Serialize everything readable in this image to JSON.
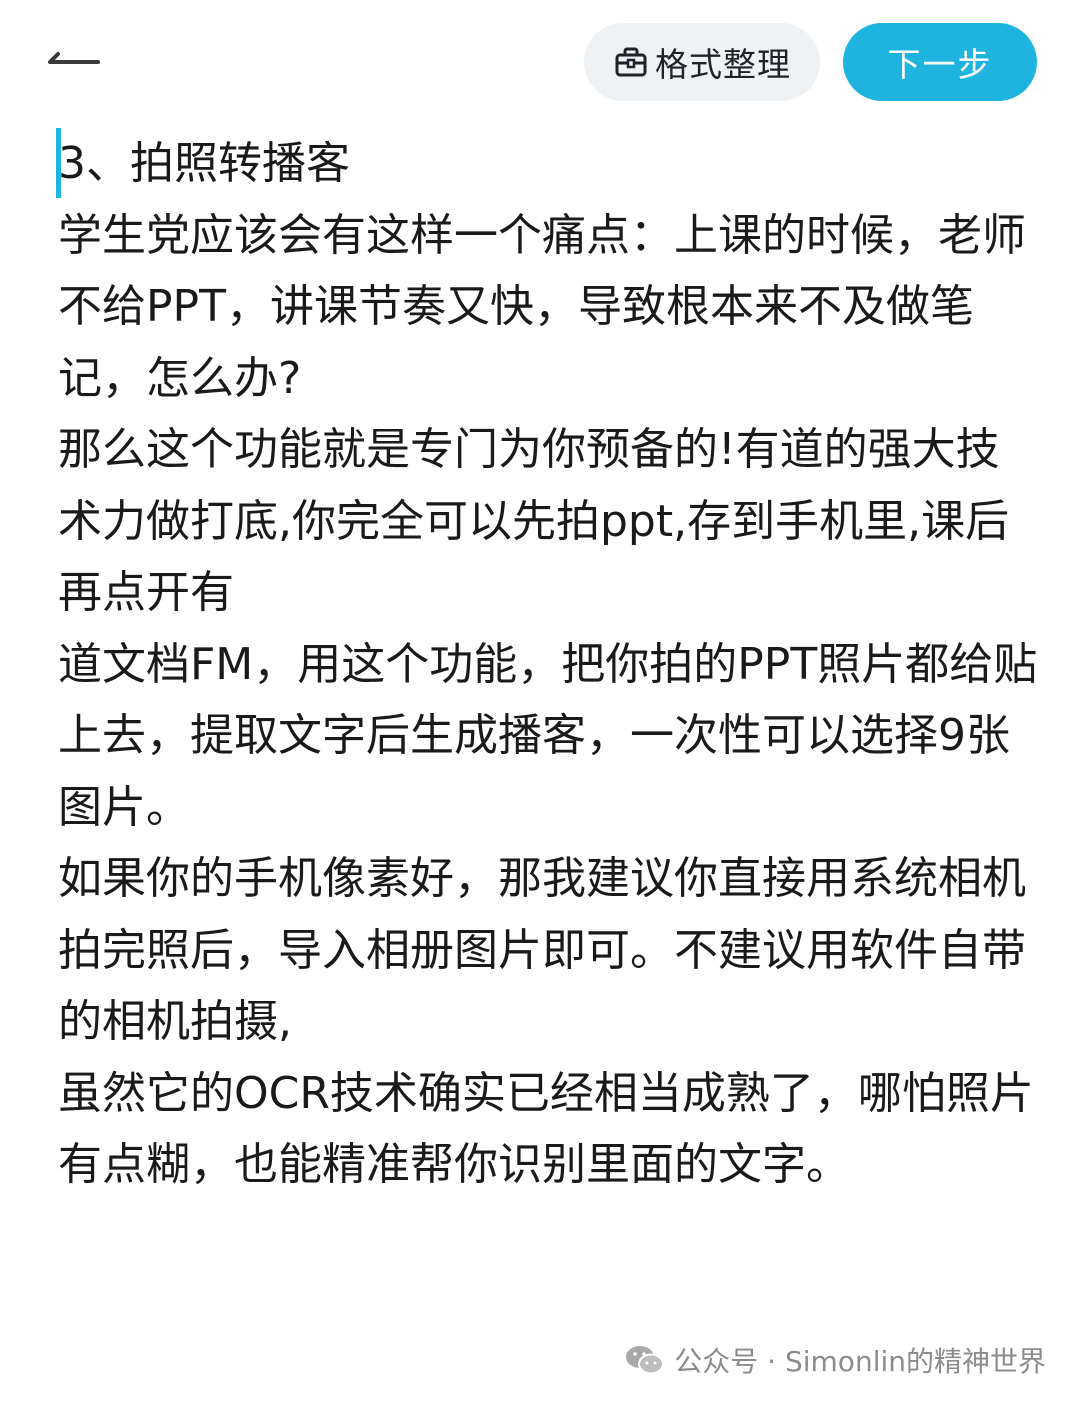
{
  "toolbar": {
    "format_label": "格式整理",
    "next_label": "下一步"
  },
  "icons": {
    "back": "back-arrow-icon",
    "format": "briefcase-icon",
    "watermark": "wechat-icon"
  },
  "colors": {
    "accent": "#1eb4dd",
    "format_button_bg": "#eef2f5",
    "text": "#1a1a1a",
    "watermark": "#8c8c8c"
  },
  "content": {
    "paragraphs": [
      "3、拍照转播客",
      "学生党应该会有这样一个痛点：上课的时候，老师不给PPT，讲课节奏又快，导致根本来不及做笔记，怎么办?",
      "那么这个功能就是专门为你预备的!有道的强大技术力做打底,你完全可以先拍ppt,存到手机里,课后再点开有",
      "道文档FM，用这个功能，把你拍的PPT照片都给贴上去，提取文字后生成播客，一次性可以选择9张图片。",
      "如果你的手机像素好，那我建议你直接用系统相机拍完照后，导入相册图片即可。不建议用软件自带的相机拍摄,",
      "虽然它的OCR技术确实已经相当成熟了，哪怕照片有点糊，也能精准帮你识别里面的文字。"
    ]
  },
  "watermark": {
    "text": "公众号 · Simonlin的精神世界"
  }
}
